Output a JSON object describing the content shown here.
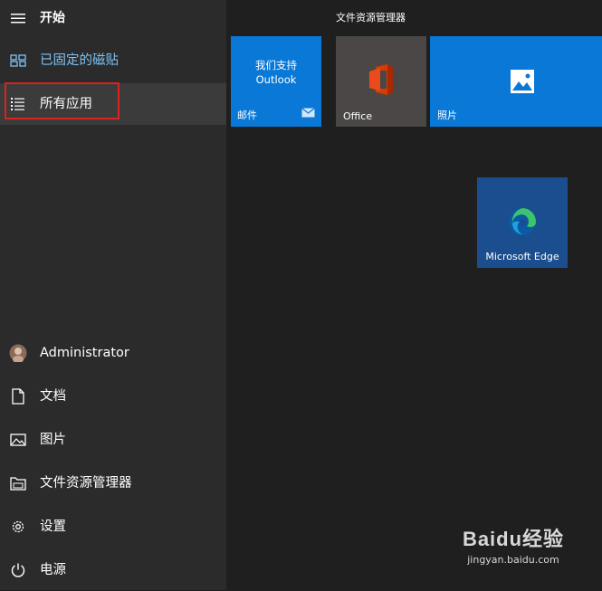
{
  "sidebar": {
    "header": {
      "label": "开始",
      "icon": "hamburger-icon"
    },
    "pinned": {
      "label": "已固定的磁贴",
      "icon": "tiles-icon"
    },
    "all_apps": {
      "label": "所有应用",
      "icon": "list-icon"
    },
    "user": {
      "label": "Administrator",
      "icon": "avatar"
    },
    "documents": {
      "label": "文档",
      "icon": "document-icon"
    },
    "pictures": {
      "label": "图片",
      "icon": "picture-icon"
    },
    "explorer": {
      "label": "文件资源管理器",
      "icon": "folder-icon"
    },
    "settings": {
      "label": "设置",
      "icon": "gear-icon"
    },
    "power": {
      "label": "电源",
      "icon": "power-icon"
    }
  },
  "tiles": {
    "group_title": "文件资源管理器",
    "mail": {
      "center_text_line1": "我们支持",
      "center_text_line2": "Outlook",
      "label": "邮件",
      "color": "#0a78d7"
    },
    "office": {
      "label": "Office",
      "color": "#4a4746"
    },
    "photos": {
      "label": "照片",
      "color": "#0a78d7"
    },
    "edge": {
      "label": "Microsoft Edge",
      "color": "#1b4e8e"
    }
  },
  "watermark": {
    "logo": "Baidu经验",
    "url": "jingyan.baidu.com"
  },
  "colors": {
    "sidebar_bg": "#2b2b2b",
    "tiles_bg": "#1f1f1f",
    "accent": "#0a78d7",
    "pinned_text": "#7dc3f5",
    "highlight_box": "#d9231c"
  }
}
